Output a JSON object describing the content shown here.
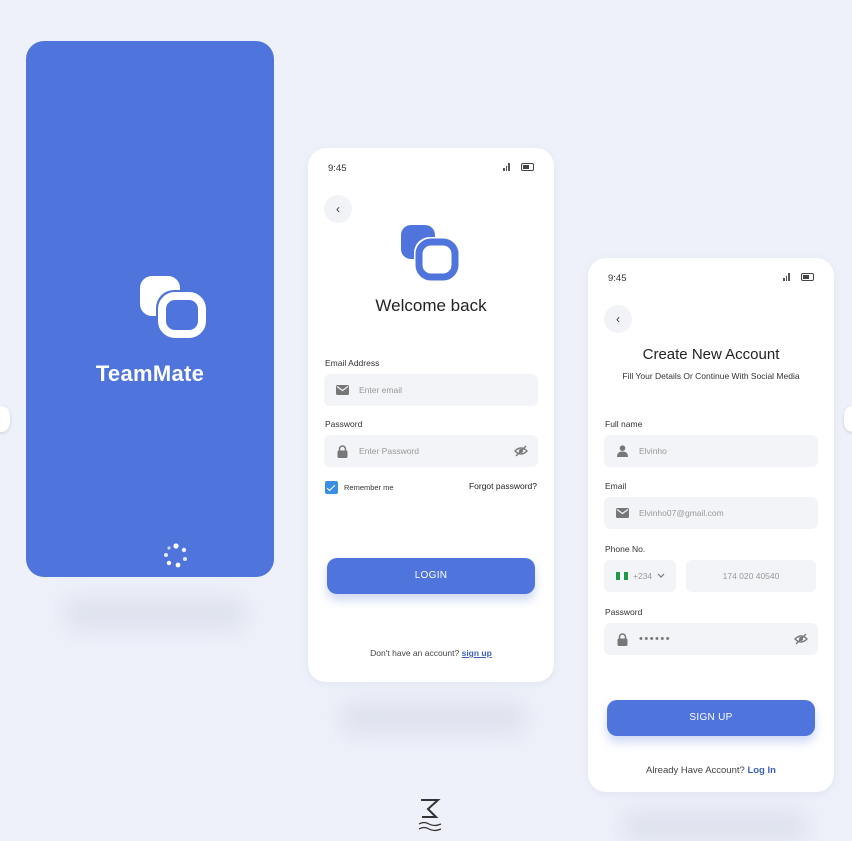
{
  "colors": {
    "brand": "#4f74dc",
    "background": "#eef1f9",
    "link": "#3a5fbf",
    "checkbox": "#3b8fe3"
  },
  "splash": {
    "app_name": "TeamMate",
    "logo_icon": "teammate-logo-icon",
    "loader_icon": "loading-spinner-icon"
  },
  "login": {
    "status_time": "9:45",
    "title": "Welcome back",
    "email_label": "Email Address",
    "email_placeholder": "Enter email",
    "password_label": "Password",
    "password_placeholder": "Enter Password",
    "remember_label": "Remember me",
    "remember_checked": true,
    "forgot_label": "Forgot password?",
    "login_button": "LOGIN",
    "footer_text": "Don't have an account?",
    "footer_link": "sign up"
  },
  "signup": {
    "status_time": "9:45",
    "title": "Create New Account",
    "subtitle": "Fill Your Details Or Continue With Social Media",
    "fullname_label": "Full name",
    "fullname_value": "Elvinho",
    "email_label": "Email",
    "email_value": "Elvinho07@gmail.com",
    "phone_label": "Phone No.",
    "country_code": "+234",
    "phone_value": "174 020 40540",
    "password_label": "Password",
    "password_value": "••••••",
    "signup_button": "SIGN UP",
    "footer_text": "Already Have Account?",
    "footer_link": "Log In"
  }
}
